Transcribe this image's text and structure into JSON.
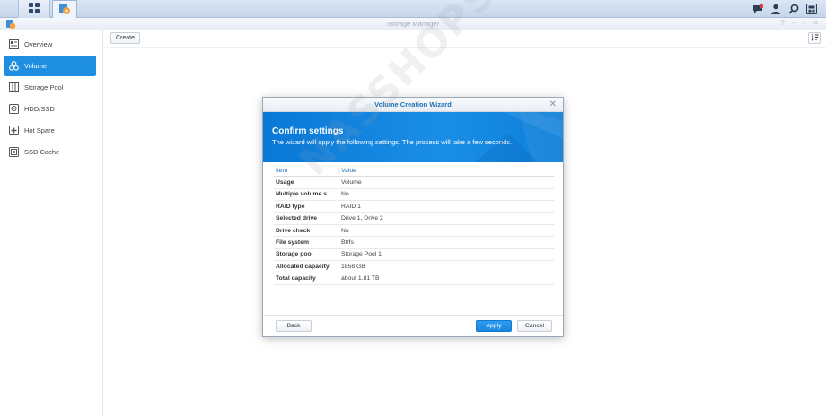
{
  "taskbar": {
    "main_menu_icon": "grid-icon",
    "app_icon": "storage-manager-app-icon",
    "right_icons": [
      "chat-notification-icon",
      "user-icon",
      "search-icon",
      "widgets-icon"
    ]
  },
  "window": {
    "title": "Storage Manager",
    "controls": [
      "?",
      "–",
      "▫",
      "✕"
    ]
  },
  "sidebar": {
    "items": [
      {
        "label": "Overview",
        "icon": "overview-icon"
      },
      {
        "label": "Volume",
        "icon": "volume-icon",
        "active": true
      },
      {
        "label": "Storage Pool",
        "icon": "storage-pool-icon"
      },
      {
        "label": "HDD/SSD",
        "icon": "hdd-icon"
      },
      {
        "label": "Hot Spare",
        "icon": "hot-spare-icon"
      },
      {
        "label": "SSD Cache",
        "icon": "ssd-cache-icon"
      }
    ]
  },
  "toolbar": {
    "create_label": "Create"
  },
  "dialog": {
    "title": "Volume Creation Wizard",
    "heading": "Confirm settings",
    "subheading": "The wizard will apply the following settings. The process will take a few seconds.",
    "table": {
      "headers": [
        "Item",
        "Value"
      ],
      "rows": [
        [
          "Usage",
          "Volume"
        ],
        [
          "Multiple volume s...",
          "No"
        ],
        [
          "RAID type",
          "RAID 1"
        ],
        [
          "Selected drive",
          "Drive 1, Drive 2"
        ],
        [
          "Drive check",
          "No"
        ],
        [
          "File system",
          "Btrfs"
        ],
        [
          "Storage pool",
          "Storage Pool 1"
        ],
        [
          "Allocated capacity",
          "1858 GB"
        ],
        [
          "Total capacity",
          "about 1.81 TB"
        ]
      ]
    },
    "back_label": "Back",
    "apply_label": "Apply",
    "cancel_label": "Cancel"
  },
  "watermark": "NASSHOPS.VN",
  "colors": {
    "accent": "#1e8fe0",
    "header_blue": "#0a78d6",
    "title_blue": "#1d6fb5"
  }
}
